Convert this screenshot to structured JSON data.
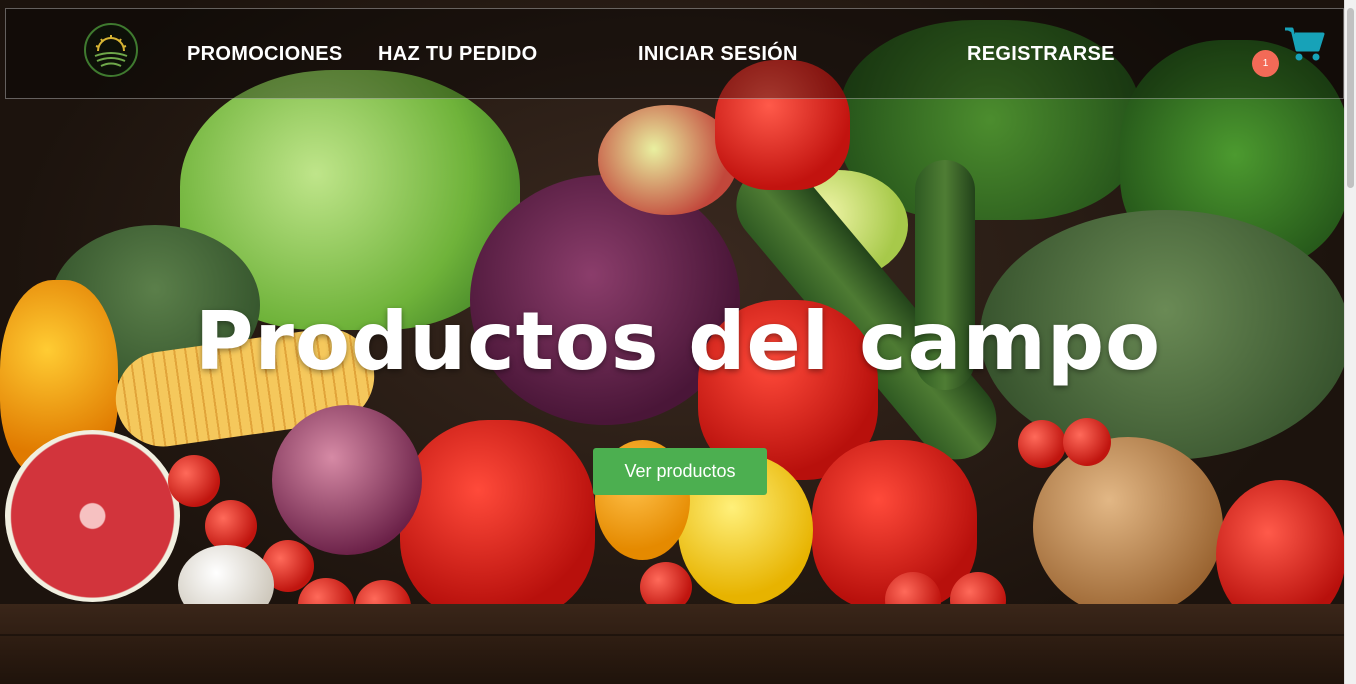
{
  "nav": {
    "logo_icon": "sunrise-field-logo",
    "links": [
      "PROMOCIONES",
      "HAZ TU PEDIDO",
      "INICIAR SESIÓN",
      "REGISTRARSE"
    ],
    "cart_icon": "shopping-cart-icon",
    "cart_count": "1"
  },
  "hero": {
    "title": "Productos del campo",
    "cta_label": "Ver productos"
  },
  "colors": {
    "cta": "#4caf50",
    "cart": "#17a2b8",
    "badge": "#f36a57"
  }
}
